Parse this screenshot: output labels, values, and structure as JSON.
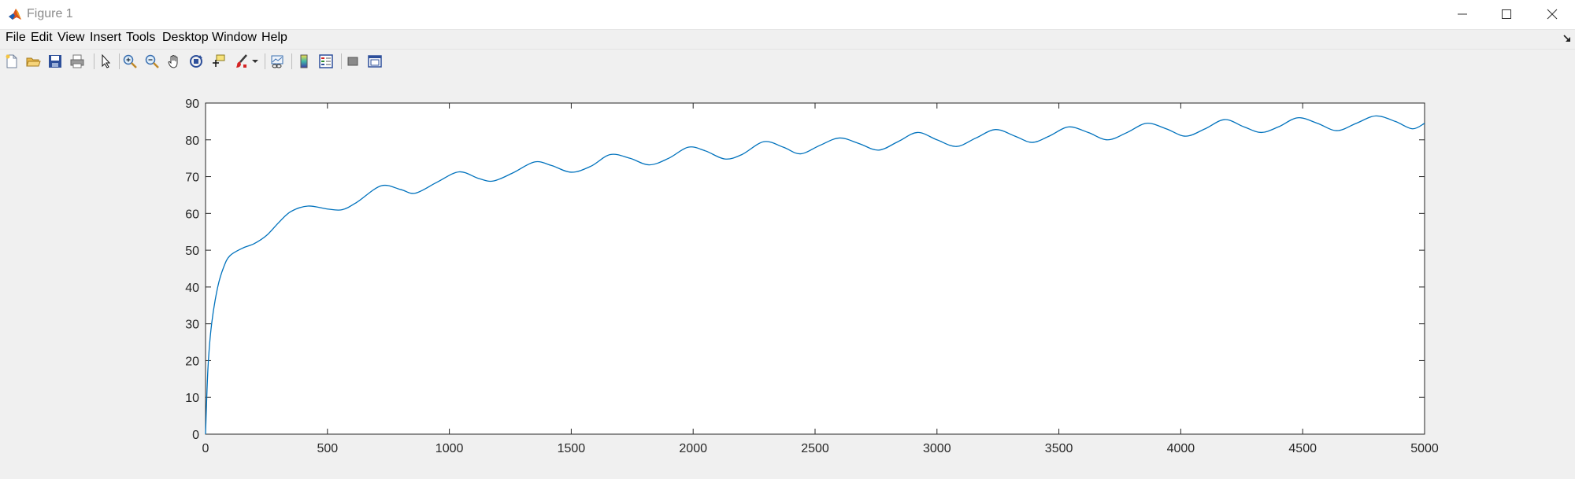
{
  "window": {
    "title": "Figure 1"
  },
  "menu": [
    "File",
    "Edit",
    "View",
    "Insert",
    "Tools",
    "Desktop",
    "Window",
    "Help"
  ],
  "toolbar": {
    "icons": [
      "new-figure-icon",
      "open-file-icon",
      "save-icon",
      "print-icon",
      "edit-plot-arrow-icon",
      "zoom-in-icon",
      "zoom-out-icon",
      "pan-hand-icon",
      "rotate-3d-icon",
      "data-cursor-icon",
      "brush-icon",
      "brush-dropdown-icon",
      "link-plot-icon",
      "colorbar-icon",
      "legend-icon",
      "hide-plot-tools-icon",
      "show-plot-tools-icon"
    ]
  },
  "colors": {
    "line": "#0072bd",
    "axes": "#262626",
    "figure_bg": "#f0f0f0"
  },
  "chart_data": {
    "type": "line",
    "title": "",
    "xlabel": "",
    "ylabel": "",
    "xlim": [
      0,
      5000
    ],
    "ylim": [
      0,
      90
    ],
    "xticks": [
      0,
      500,
      1000,
      1500,
      2000,
      2500,
      3000,
      3500,
      4000,
      4500,
      5000
    ],
    "yticks": [
      0,
      10,
      20,
      30,
      40,
      50,
      60,
      70,
      80,
      90
    ],
    "grid": false,
    "series": [
      {
        "color": "#0072bd",
        "x": [
          0,
          10,
          25,
          50,
          75,
          100,
          150,
          200,
          250,
          300,
          350,
          420,
          500,
          560,
          620,
          720,
          800,
          860,
          950,
          1040,
          1120,
          1180,
          1260,
          1350,
          1420,
          1500,
          1580,
          1660,
          1740,
          1820,
          1900,
          1980,
          2050,
          2130,
          2200,
          2290,
          2370,
          2440,
          2520,
          2600,
          2680,
          2760,
          2840,
          2920,
          3000,
          3080,
          3160,
          3240,
          3320,
          3390,
          3460,
          3540,
          3620,
          3700,
          3780,
          3860,
          3940,
          4020,
          4100,
          4180,
          4260,
          4330,
          4400,
          4480,
          4560,
          4640,
          4720,
          4800,
          4880,
          4950,
          5000
        ],
        "y": [
          0,
          18,
          30,
          40,
          45.5,
          48.5,
          50.5,
          51.8,
          54,
          57.5,
          60.5,
          62,
          61.2,
          61,
          63,
          67.5,
          66.5,
          65.5,
          68.5,
          71.3,
          69.5,
          68.8,
          71,
          74,
          73,
          71.2,
          72.8,
          76,
          75,
          73.2,
          75,
          78,
          77,
          74.8,
          76,
          79.5,
          78,
          76.2,
          78.5,
          80.5,
          79,
          77.2,
          79.5,
          82,
          80,
          78.2,
          80.5,
          82.8,
          81,
          79.3,
          81,
          83.5,
          82,
          80,
          82,
          84.5,
          83,
          81,
          83,
          85.5,
          83.5,
          82,
          83.5,
          86,
          84.5,
          82.5,
          84.5,
          86.5,
          85,
          83,
          84.5
        ]
      }
    ]
  }
}
